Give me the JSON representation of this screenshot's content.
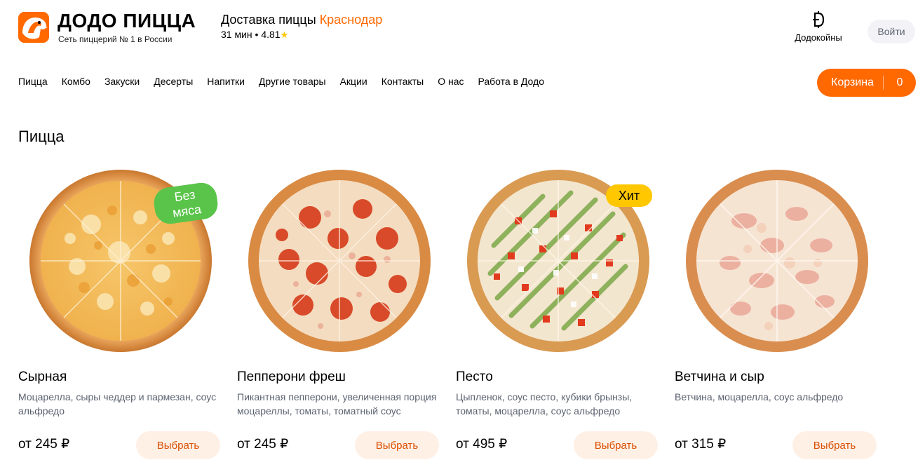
{
  "header": {
    "brand_title": "ДОДО ПИЦЦА",
    "brand_subtitle": "Сеть пиццерий № 1 в России",
    "delivery_label": "Доставка пиццы",
    "city": "Краснодар",
    "delivery_time": "31 мин",
    "separator": "•",
    "rating": "4.81",
    "rating_icon": "star-icon",
    "coins_label": "Додокойны",
    "login_label": "Войти",
    "accent_color": "#ff6900"
  },
  "nav": {
    "items": [
      {
        "label": "Пицца"
      },
      {
        "label": "Комбо"
      },
      {
        "label": "Закуски"
      },
      {
        "label": "Десерты"
      },
      {
        "label": "Напитки"
      },
      {
        "label": "Другие товары"
      },
      {
        "label": "Акции"
      },
      {
        "label": "Контакты"
      },
      {
        "label": "О нас"
      },
      {
        "label": "Работа в Додо"
      }
    ],
    "cart_label": "Корзина",
    "cart_count": "0"
  },
  "section_title": "Пицца",
  "products": [
    {
      "name": "Сырная",
      "description": "Моцарелла, сыры чеддер и пармезан, соус альфредо",
      "price": "от 245 ₽",
      "button": "Выбрать",
      "badge": "Без мяса",
      "badge_line1": "Без",
      "badge_line2": "мяса",
      "badge_color": "#5ac44a"
    },
    {
      "name": "Пепперони фреш",
      "description": "Пикантная пепперони, увеличенная порция моцареллы, томаты, томатный соус",
      "price": "от 245 ₽",
      "button": "Выбрать"
    },
    {
      "name": "Песто",
      "description": "Цыпленок, соус песто, кубики брынзы, томаты, моцарелла, соус альфредо",
      "price": "от 495 ₽",
      "button": "Выбрать",
      "badge": "Хит",
      "badge_color": "#ffc700"
    },
    {
      "name": "Ветчина и сыр",
      "description": "Ветчина, моцарелла, соус альфредо",
      "price": "от 315 ₽",
      "button": "Выбрать"
    }
  ]
}
